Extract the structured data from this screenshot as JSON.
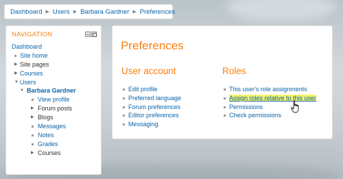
{
  "breadcrumb": {
    "items": [
      "Dashboard",
      "Users",
      "Barbara Gardner",
      "Preferences"
    ]
  },
  "navigation": {
    "title": "NAVIGATION",
    "items": [
      {
        "label": "Dashboard"
      },
      {
        "label": "Site home"
      },
      {
        "label": "Site pages"
      },
      {
        "label": "Courses"
      },
      {
        "label": "Users"
      },
      {
        "label": "Barbara Gardner"
      },
      {
        "label": "View profile"
      },
      {
        "label": "Forum posts"
      },
      {
        "label": "Blogs"
      },
      {
        "label": "Messages"
      },
      {
        "label": "Notes"
      },
      {
        "label": "Grades"
      },
      {
        "label": "Courses"
      }
    ]
  },
  "main": {
    "title": "Preferences",
    "user_account": {
      "heading": "User account",
      "links": [
        "Edit profile",
        "Preferred language",
        "Forum preferences",
        "Editor preferences",
        "Messaging"
      ]
    },
    "roles": {
      "heading": "Roles",
      "links": [
        "This user's role assignments",
        "Assign roles relative to this user",
        "Permissions",
        "Check permissions"
      ]
    }
  },
  "colors": {
    "accent": "#f98012",
    "link": "#0a63a8",
    "highlight": "#f3f36a"
  }
}
